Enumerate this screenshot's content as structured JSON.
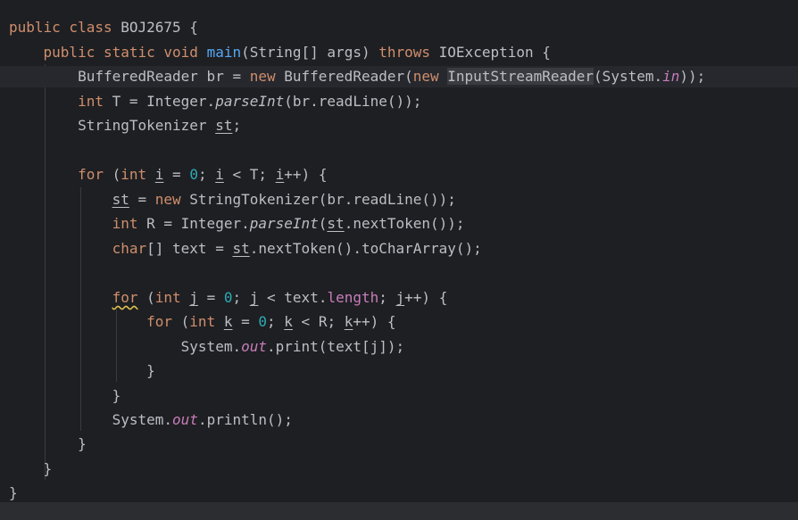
{
  "editor": {
    "class_decl": {
      "kw": "public class ",
      "name": "BOJ2675 {"
    },
    "main_decl": {
      "kw1": "public static void ",
      "name": "main",
      "args": "(String[] args) ",
      "kw2": "throws ",
      "rest": "IOException {"
    },
    "br_line": {
      "t1": "BufferedReader br = ",
      "kw1": "new ",
      "t2": "BufferedReader(",
      "kw2": "new ",
      "hl": "InputStreamReader",
      "t3": "(System.",
      "fld": "in",
      "t4": "));"
    },
    "t_line": {
      "kw": "int ",
      "t1": "T = Integer.",
      "m": "parseInt",
      "t2": "(br.readLine());"
    },
    "st_decl": {
      "t1": "StringTokenizer ",
      "var": "st",
      "t2": ";"
    },
    "for1": {
      "kw": "for ",
      "t1": "(",
      "kw2": "int ",
      "v1": "i",
      "t2": " = ",
      "n": "0",
      "t3": "; ",
      "v2": "i",
      "t4": " < T; ",
      "v3": "i",
      "t5": "++) {"
    },
    "st_assign": {
      "var": "st",
      "t1": " = ",
      "kw": "new ",
      "t2": "StringTokenizer(br.readLine());"
    },
    "r_line": {
      "kw": "int ",
      "t1": "R = Integer.",
      "m": "parseInt",
      "t2": "(",
      "var": "st",
      "t3": ".nextToken());"
    },
    "text_line": {
      "kw": "char",
      "t1": "[] text = ",
      "var": "st",
      "t2": ".nextToken().toCharArray();"
    },
    "for2": {
      "kw": "for",
      "t1": " (",
      "kw2": "int ",
      "v1": "j",
      "t2": " = ",
      "n": "0",
      "t3": "; ",
      "v2": "j",
      "t4": " < text.",
      "fld": "length",
      "t5": "; ",
      "v3": "j",
      "t6": "++) {"
    },
    "for3": {
      "kw": "for ",
      "t1": "(",
      "kw2": "int ",
      "v1": "k",
      "t2": " = ",
      "n": "0",
      "t3": "; ",
      "v2": "k",
      "t4": " < R; ",
      "v3": "k",
      "t5": "++) {"
    },
    "print_line": {
      "t1": "System.",
      "fld": "out",
      "t2": ".print(text[j]);"
    },
    "close_brace": "}",
    "println_line": {
      "t1": "System.",
      "fld": "out",
      "t2": ".println();"
    }
  }
}
